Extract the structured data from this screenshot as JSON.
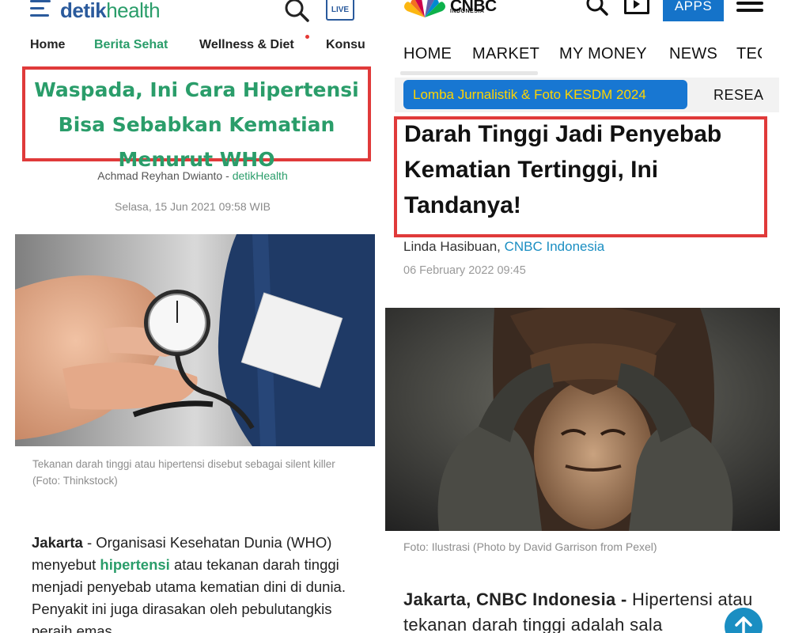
{
  "detik": {
    "logo_part1": "detik",
    "logo_part2": "health",
    "live_label": "LIVE",
    "nav": [
      "Home",
      "Berita Sehat",
      "Wellness & Diet",
      "Konsu"
    ],
    "title": "Waspada, Ini Cara Hipertensi Bisa Sebabkan Kematian Menurut WHO",
    "author": "Achmad Reyhan Dwianto",
    "author_sep": " - ",
    "source": "detikHealth",
    "date": "Selasa, 15 Jun 2021 09:58 WIB",
    "caption": "Tekanan darah tinggi atau hipertensi disebut sebagai silent killer (Foto: Thinkstock)",
    "body_lead": "Jakarta",
    "body_p1": " - Organisasi Kesehatan Dunia (WHO) menyebut ",
    "body_link": "hipertensi",
    "body_p2": " atau tekanan darah tinggi menjadi penyebab utama kematian dini di dunia. Penyakit ini juga dirasakan oleh pebulutangkis peraih emas",
    "colors": {
      "brand_blue": "#2a5a9c",
      "brand_green": "#2a9d6a",
      "highlight_red": "#e03a3a"
    }
  },
  "cnbc": {
    "logo": "CNBC",
    "logo_sub": "INDONESIA",
    "apps_label": "APPS",
    "nav": [
      "HOME",
      "MARKET",
      "MY MONEY",
      "NEWS",
      "TEC"
    ],
    "promo_pill": "Lomba Jurnalistik & Foto KESDM 2024",
    "promo_next": "RESEA",
    "title": "Darah Tinggi Jadi Penyebab Kematian Tertinggi, Ini Tandanya!",
    "author": "Linda Hasibuan, ",
    "source": "CNBC Indonesia",
    "date": "06 February 2022 09:45",
    "caption": "Foto: Ilustrasi (Photo by David Garrison from Pexel)",
    "body_lead": "Jakarta, CNBC Indonesia - ",
    "body_text": "Hipertensi atau tekanan darah tinggi adalah sala",
    "colors": {
      "brand_blue": "#1573c9",
      "promo_yellow": "#ffd400",
      "link_blue": "#1a8ec2",
      "highlight_red": "#e03a3a"
    }
  },
  "icons": [
    "menu-icon",
    "search-icon",
    "live-tv-icon",
    "cnbc-peacock-icon",
    "play-video-icon",
    "hamburger-icon",
    "scroll-up-arrow-icon"
  ]
}
